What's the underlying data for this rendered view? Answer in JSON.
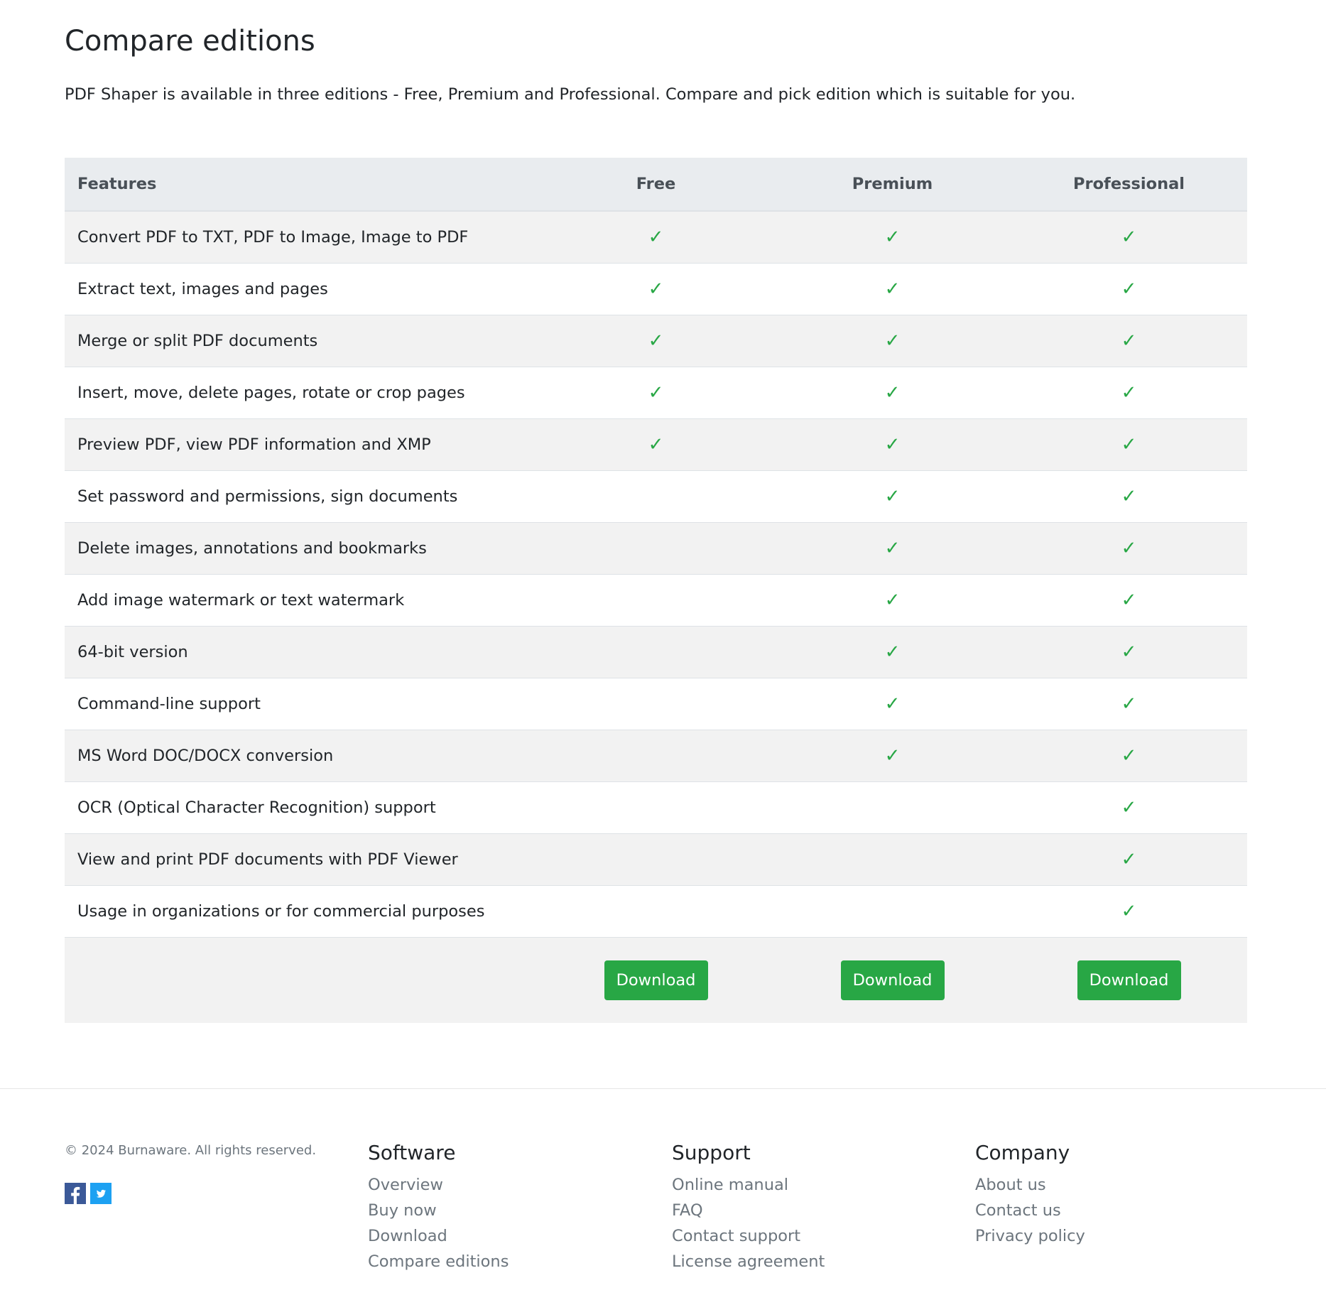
{
  "page": {
    "title": "Compare editions",
    "intro": "PDF Shaper is available in three editions - Free, Premium and Professional. Compare and pick edition which is suitable for you."
  },
  "table": {
    "headers": {
      "features": "Features",
      "free": "Free",
      "premium": "Premium",
      "professional": "Professional"
    },
    "check_glyph": "✓",
    "check_color": "#28a745",
    "rows": [
      {
        "feature": "Convert PDF to TXT, PDF to Image, Image to PDF",
        "free": true,
        "premium": true,
        "professional": true
      },
      {
        "feature": "Extract text, images and pages",
        "free": true,
        "premium": true,
        "professional": true
      },
      {
        "feature": "Merge or split PDF documents",
        "free": true,
        "premium": true,
        "professional": true
      },
      {
        "feature": "Insert, move, delete pages, rotate or crop pages",
        "free": true,
        "premium": true,
        "professional": true
      },
      {
        "feature": "Preview PDF, view PDF information and XMP",
        "free": true,
        "premium": true,
        "professional": true
      },
      {
        "feature": "Set password and permissions, sign documents",
        "free": false,
        "premium": true,
        "professional": true
      },
      {
        "feature": "Delete images, annotations and bookmarks",
        "free": false,
        "premium": true,
        "professional": true
      },
      {
        "feature": "Add image watermark or text watermark",
        "free": false,
        "premium": true,
        "professional": true
      },
      {
        "feature": "64-bit version",
        "free": false,
        "premium": true,
        "professional": true
      },
      {
        "feature": "Command-line support",
        "free": false,
        "premium": true,
        "professional": true
      },
      {
        "feature": "MS Word DOC/DOCX conversion",
        "free": false,
        "premium": true,
        "professional": true
      },
      {
        "feature": "OCR (Optical Character Recognition) support",
        "free": false,
        "premium": false,
        "professional": true
      },
      {
        "feature": "View and print PDF documents with PDF Viewer",
        "free": false,
        "premium": false,
        "professional": true
      },
      {
        "feature": "Usage in organizations or for commercial purposes",
        "free": false,
        "premium": false,
        "professional": true
      }
    ],
    "download_label": "Download",
    "download_color": "#28a745"
  },
  "footer": {
    "copyright": "© 2024 Burnaware. All rights reserved.",
    "social": [
      {
        "icon": "facebook-icon",
        "glyph": "f",
        "color": "#3b5998"
      },
      {
        "icon": "twitter-icon",
        "glyph": "t",
        "color": "#1da1f2"
      }
    ],
    "software": {
      "heading": "Software",
      "links": [
        "Overview",
        "Buy now",
        "Download",
        "Compare editions"
      ]
    },
    "support": {
      "heading": "Support",
      "links": [
        "Online manual",
        "FAQ",
        "Contact support",
        "License agreement"
      ]
    },
    "company": {
      "heading": "Company",
      "links": [
        "About us",
        "Contact us",
        "Privacy policy"
      ]
    }
  }
}
